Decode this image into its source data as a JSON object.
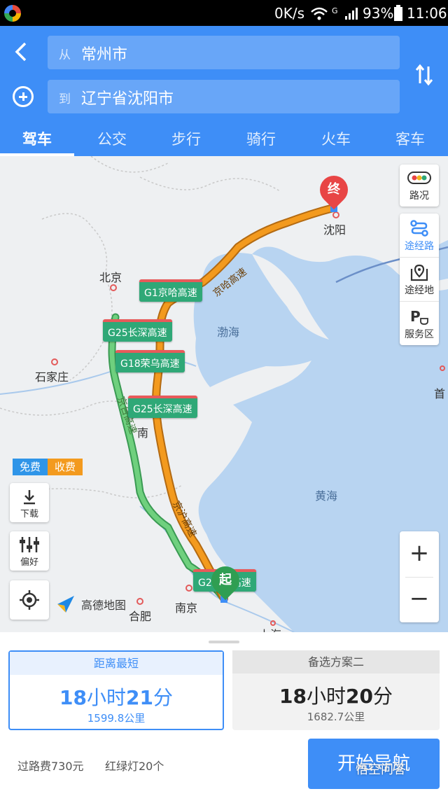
{
  "status_bar": {
    "network_speed": "0K/s",
    "battery": "93%",
    "time": "11:06",
    "network_type": "G"
  },
  "route_search": {
    "from_prefix": "从",
    "from_value": "常州市",
    "to_prefix": "到",
    "to_value": "辽宁省沈阳市"
  },
  "tabs": [
    {
      "label": "驾车",
      "active": true
    },
    {
      "label": "公交"
    },
    {
      "label": "步行"
    },
    {
      "label": "骑行"
    },
    {
      "label": "火车"
    },
    {
      "label": "客车"
    }
  ],
  "map": {
    "places": {
      "beijing": "北京",
      "shijiazhuang": "石家庄",
      "shenyang": "沈阳",
      "nanjing": "南京",
      "hefei": "合肥",
      "jinan_partial": "南",
      "shanghai_partial": "上海",
      "edge_partial": "首"
    },
    "seas": {
      "bohai": "渤海",
      "huanghai": "黄海"
    },
    "pins": {
      "end": "终",
      "start": "起"
    },
    "road_labels": {
      "g1": "G1京哈高速",
      "g25_top": "G25长深高速",
      "g18": "G18荣乌高速",
      "g25_mid": "G25长深高速",
      "g2": "G2京沪高速"
    },
    "road_names": {
      "jingha": "京哈高速",
      "jinghu": "京沪高速",
      "jingtai": "京台高速"
    },
    "right_panel": {
      "traffic": "路况",
      "via_route": "途经路",
      "via_place": "途经地",
      "service": "服务区"
    },
    "legend": {
      "free": "免费",
      "toll": "收费",
      "free_color": "#2f95e8",
      "toll_color": "#f39a1e"
    },
    "side_buttons": {
      "download": "下载",
      "preference": "偏好"
    },
    "zoom": {
      "in": "+",
      "out": "−"
    },
    "watermark": "高德地图",
    "route_colors": {
      "main": "#f39a1e",
      "alt": "#5cc26a"
    }
  },
  "routes": [
    {
      "title": "距离最短",
      "hours": "18",
      "minutes": "21",
      "time_h_unit": "小时",
      "time_m_unit": "分",
      "distance": "1599.8公里",
      "selected": true
    },
    {
      "title": "备选方案二",
      "hours": "18",
      "minutes": "20",
      "time_h_unit": "小时",
      "time_m_unit": "分",
      "distance": "1682.7公里",
      "selected": false
    }
  ],
  "trip_info": {
    "toll": "过路费730元",
    "lights": "红绿灯20个"
  },
  "start_button": "开始导航",
  "overlay_watermark": "悟空问答",
  "colors": {
    "accent": "#3e8ef7",
    "header": "#3e8ef7"
  }
}
